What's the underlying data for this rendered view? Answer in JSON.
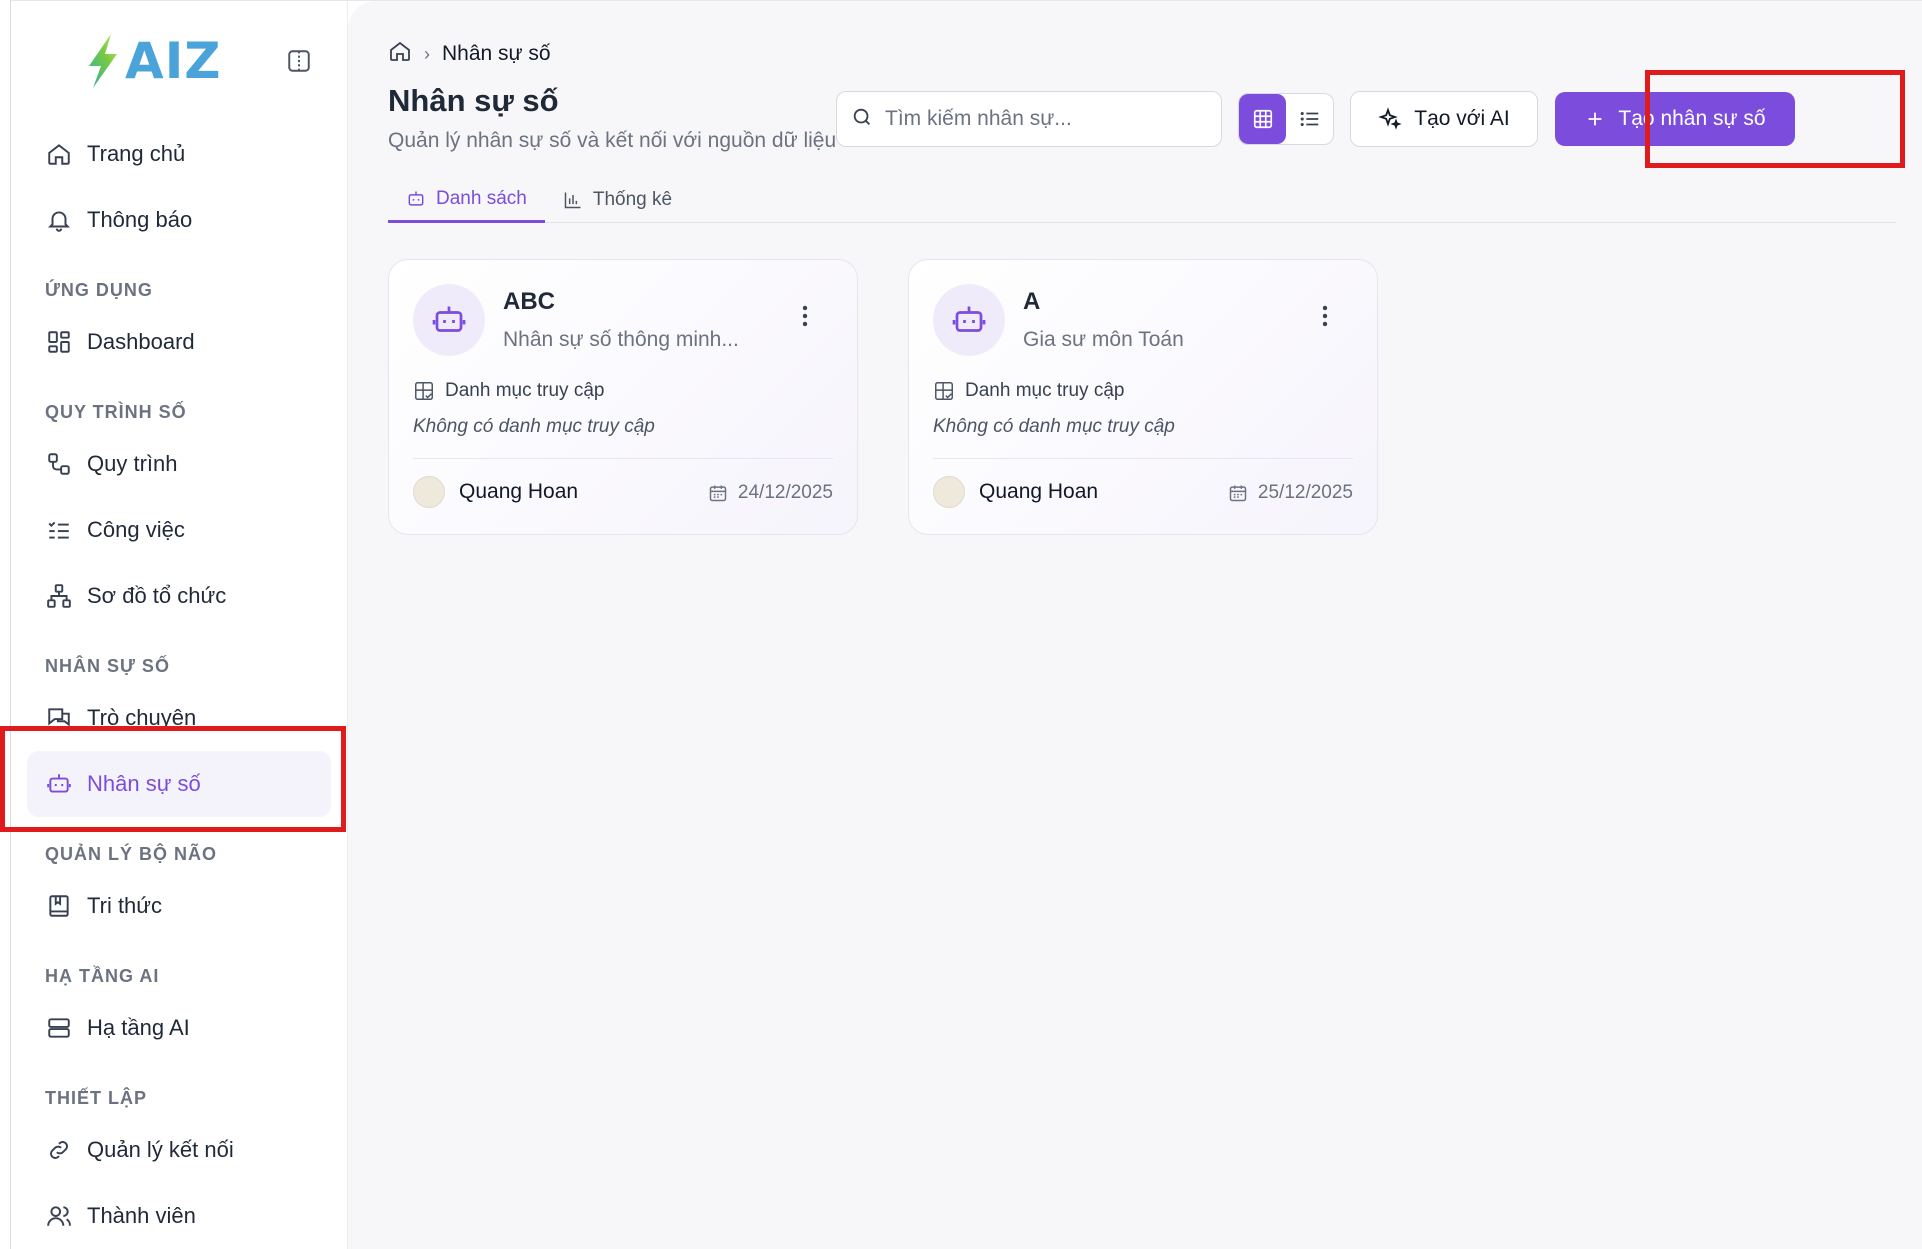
{
  "brand": {
    "logo_text": "AIZ"
  },
  "sidebar": {
    "top_items": [
      {
        "label": "Trang chủ",
        "icon": "home-icon"
      },
      {
        "label": "Thông báo",
        "icon": "bell-icon"
      }
    ],
    "sections": [
      {
        "title": "ỨNG DỤNG",
        "items": [
          {
            "label": "Dashboard",
            "icon": "dashboard-icon"
          }
        ]
      },
      {
        "title": "QUY TRÌNH SỐ",
        "items": [
          {
            "label": "Quy trình",
            "icon": "workflow-icon"
          },
          {
            "label": "Công việc",
            "icon": "task-list-icon"
          },
          {
            "label": "Sơ đồ tổ chức",
            "icon": "org-chart-icon"
          }
        ]
      },
      {
        "title": "NHÂN SỰ SỐ",
        "items": [
          {
            "label": "Trò chuyện",
            "icon": "chat-icon"
          },
          {
            "label": "Nhân sự số",
            "icon": "bot-icon",
            "active": true
          }
        ]
      },
      {
        "title": "QUẢN LÝ BỘ NÃO",
        "items": [
          {
            "label": "Tri thức",
            "icon": "book-icon"
          }
        ]
      },
      {
        "title": "HẠ TẦNG AI",
        "items": [
          {
            "label": "Hạ tầng AI",
            "icon": "server-icon"
          }
        ]
      },
      {
        "title": "THIẾT LẬP",
        "items": [
          {
            "label": "Quản lý kết nối",
            "icon": "link-icon"
          },
          {
            "label": "Thành viên",
            "icon": "users-icon"
          }
        ]
      }
    ]
  },
  "header": {
    "breadcrumb_current": "Nhân sự số",
    "title": "Nhân sự số",
    "subtitle": "Quản lý nhân sự số và kết nối với nguồn dữ liệu",
    "search_placeholder": "Tìm kiếm nhân sự...",
    "ai_button": "Tạo với AI",
    "create_button": "Tạo nhân sự số"
  },
  "tabs": [
    {
      "label": "Danh sách",
      "active": true
    },
    {
      "label": "Thống kê",
      "active": false
    }
  ],
  "cards": [
    {
      "name": "ABC",
      "description": "Nhân sự số thông minh...",
      "perm_label": "Danh mục truy cập",
      "perm_empty": "Không có danh mục truy cập",
      "owner": "Quang Hoan",
      "date": "24/12/2025"
    },
    {
      "name": "A",
      "description": "Gia sư môn Toán",
      "perm_label": "Danh mục truy cập",
      "perm_empty": "Không có danh mục truy cập",
      "owner": "Quang Hoan",
      "date": "25/12/2025"
    }
  ],
  "colors": {
    "accent": "#7c4ddc",
    "highlight": "#e01b1b"
  }
}
